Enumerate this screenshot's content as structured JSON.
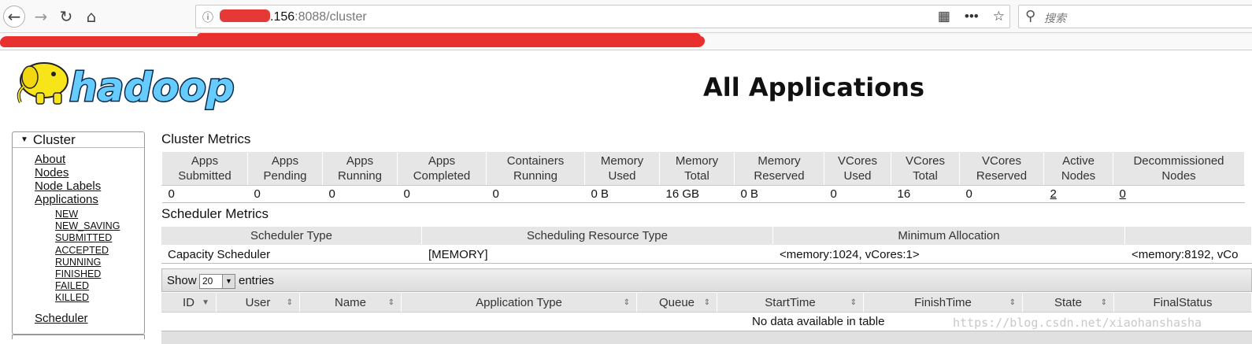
{
  "browser": {
    "url_host_suffix": ".156",
    "url_port_path": ":8088/cluster",
    "search_placeholder": "搜索"
  },
  "page": {
    "logo_text": "hadoop",
    "title": "All Applications"
  },
  "sidebar": {
    "header": "Cluster",
    "links": [
      "About",
      "Nodes",
      "Node Labels",
      "Applications"
    ],
    "states": [
      "NEW",
      "NEW_SAVING",
      "SUBMITTED",
      "ACCEPTED",
      "RUNNING",
      "FINISHED",
      "FAILED",
      "KILLED"
    ],
    "scheduler": "Scheduler"
  },
  "cluster_metrics": {
    "title": "Cluster Metrics",
    "headers": [
      [
        "Apps",
        "Submitted"
      ],
      [
        "Apps",
        "Pending"
      ],
      [
        "Apps",
        "Running"
      ],
      [
        "Apps",
        "Completed"
      ],
      [
        "Containers",
        "Running"
      ],
      [
        "Memory",
        "Used"
      ],
      [
        "Memory",
        "Total"
      ],
      [
        "Memory",
        "Reserved"
      ],
      [
        "VCores",
        "Used"
      ],
      [
        "VCores",
        "Total"
      ],
      [
        "VCores",
        "Reserved"
      ],
      [
        "Active",
        "Nodes"
      ],
      [
        "Decommissioned",
        "Nodes"
      ]
    ],
    "values": [
      "0",
      "0",
      "0",
      "0",
      "0",
      "0 B",
      "16 GB",
      "0 B",
      "0",
      "16",
      "0",
      "2",
      "0"
    ]
  },
  "scheduler_metrics": {
    "title": "Scheduler Metrics",
    "headers": [
      "Scheduler Type",
      "Scheduling Resource Type",
      "Minimum Allocation",
      ""
    ],
    "values": [
      "Capacity Scheduler",
      "[MEMORY]",
      "<memory:1024, vCores:1>",
      "<memory:8192, vCo"
    ]
  },
  "apps_table": {
    "show_label": "Show",
    "page_size": "20",
    "entries_label": "entries",
    "columns": [
      "ID",
      "User",
      "Name",
      "Application Type",
      "Queue",
      "StartTime",
      "FinishTime",
      "State",
      "FinalStatus"
    ],
    "empty_message": "No data available in table"
  },
  "watermark": "https://blog.csdn.net/xiaohanshasha"
}
